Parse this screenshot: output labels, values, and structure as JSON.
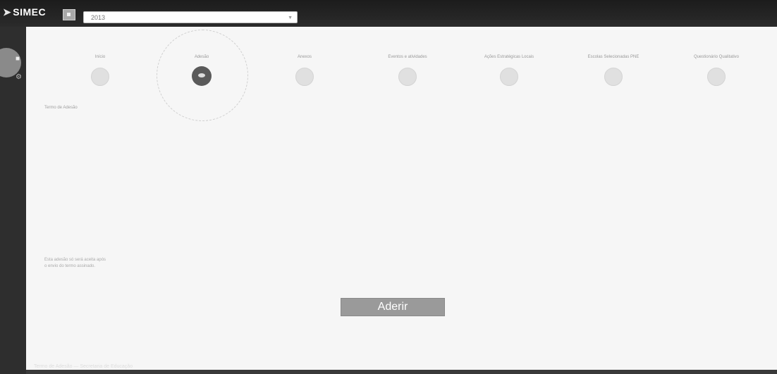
{
  "app": {
    "logo_text": "SIMEC",
    "year_select_value": "2013"
  },
  "steps": [
    {
      "label": "Início",
      "active": false
    },
    {
      "label": "Adesão",
      "active": true
    },
    {
      "label": "Anexos",
      "active": false
    },
    {
      "label": "Eventos e atividades",
      "active": false
    },
    {
      "label": "Ações Estratégicas Locais",
      "active": false
    },
    {
      "label": "Escolas Selecionadas PNE",
      "active": false
    },
    {
      "label": "Questionário Qualitativo",
      "active": false
    }
  ],
  "main": {
    "subtitle": "Termo de Adesão",
    "footnote_line1": "Esta adesão só será aceita após",
    "footnote_line2": "o envio do termo assinado.",
    "aderir_label": "Aderir"
  },
  "bottom_text": "Termo de Adesão — Secretaria de Educação"
}
